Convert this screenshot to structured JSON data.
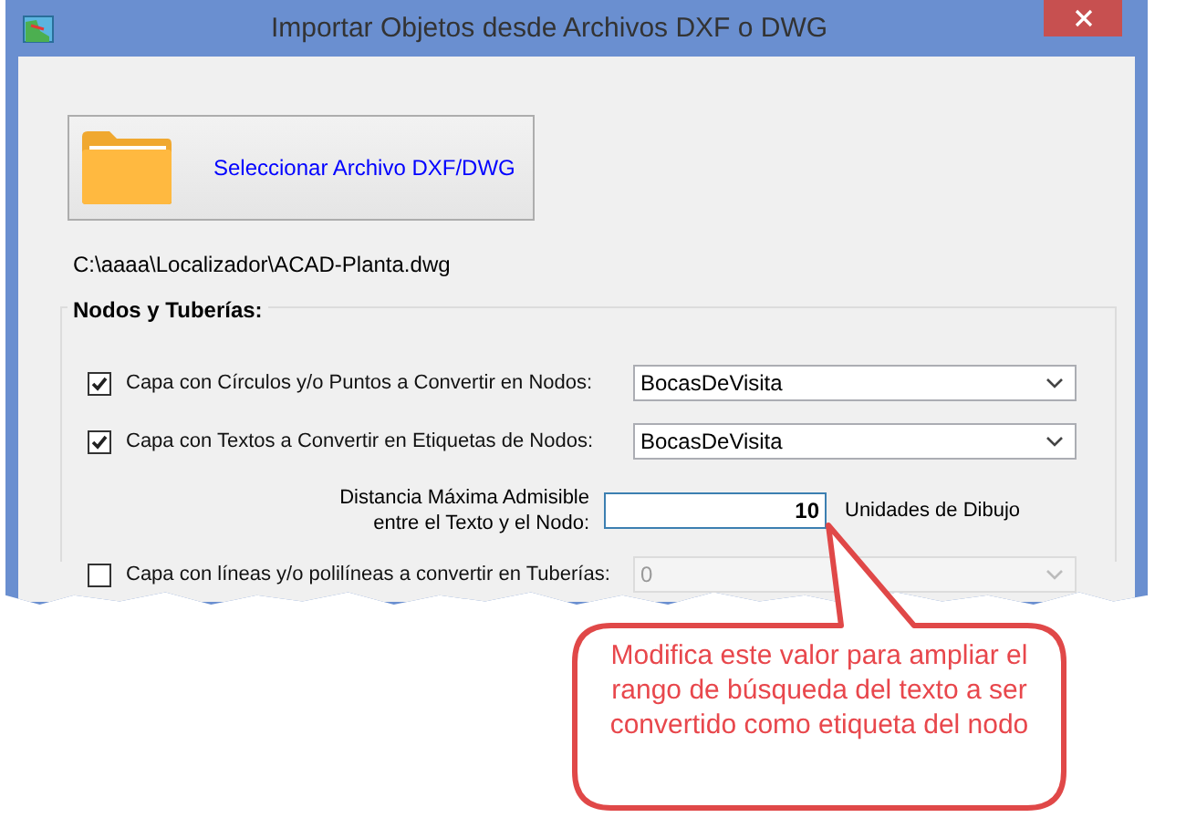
{
  "window": {
    "title": "Importar Objetos desde Archivos DXF o DWG"
  },
  "select_button": {
    "label": "Seleccionar Archivo DXF/DWG"
  },
  "file_path": "C:\\aaaa\\Localizador\\ACAD-Planta.dwg",
  "group": {
    "title": "Nodos y Tuberías:",
    "rows": [
      {
        "kind": "dropdown",
        "label": "Capa con Círculos y/o Puntos a Convertir en Nodos:",
        "checked": true,
        "value": "BocasDeVisita",
        "disabled": false
      },
      {
        "kind": "dropdown",
        "label": "Capa con Textos a Convertir en Etiquetas de Nodos:",
        "checked": true,
        "value": "BocasDeVisita",
        "disabled": false
      },
      {
        "kind": "number",
        "label": "Distancia Máxima Admisible entre el Texto y el Nodo:",
        "value": "10",
        "unit": "Unidades de Dibujo"
      },
      {
        "kind": "dropdown",
        "label": "Capa con líneas y/o polilíneas a convertir en Tuberías:",
        "checked": false,
        "value": "0",
        "disabled": true
      }
    ]
  },
  "callout": {
    "text": "Modifica este valor para ampliar el rango de búsqueda del texto a ser convertido como etiqueta del nodo"
  }
}
